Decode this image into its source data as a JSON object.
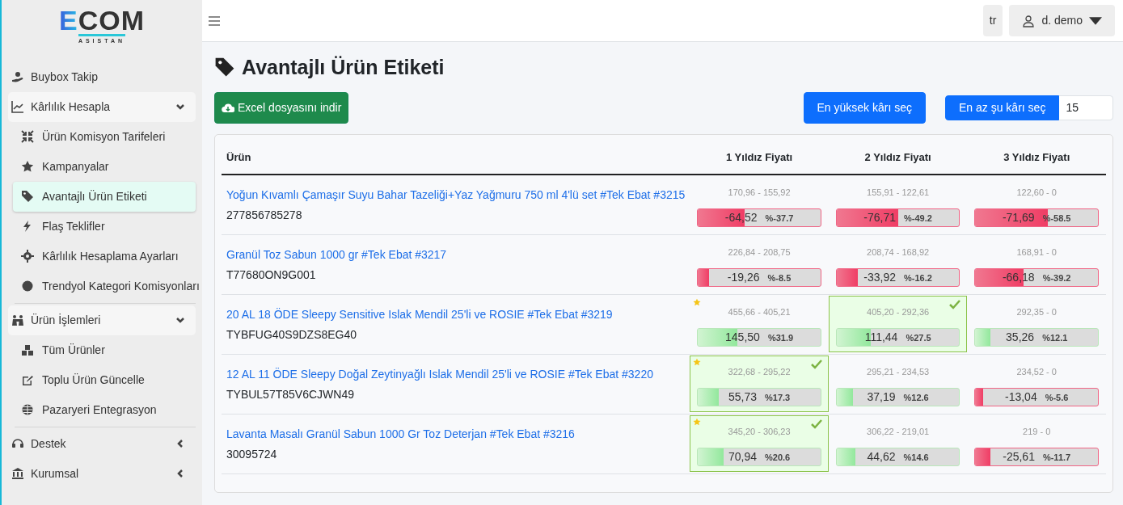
{
  "logo": {
    "text": "ECOM",
    "tagline": "ASISTAN"
  },
  "sidebar": {
    "items": [
      {
        "label": "Buybox Takip"
      },
      {
        "label": "Kârlılık Hesapla",
        "expanded": true,
        "children": [
          {
            "label": "Ürün Komisyon Tarifeleri",
            "selected": false
          },
          {
            "label": "Kampanyalar",
            "selected": false
          },
          {
            "label": "Avantajlı Ürün Etiketi",
            "selected": true
          },
          {
            "label": "Flaş Teklifler",
            "selected": false
          },
          {
            "label": "Kârlılık Hesaplama Ayarları",
            "selected": false
          },
          {
            "label": "Trendyol Kategori Komisyonları",
            "selected": false
          }
        ]
      },
      {
        "label": "Ürün İşlemleri",
        "expanded": true,
        "children": [
          {
            "label": "Tüm Ürünler",
            "selected": false
          },
          {
            "label": "Toplu Ürün Güncelle",
            "selected": false
          },
          {
            "label": "Pazaryeri Entegrasyon",
            "selected": false
          }
        ]
      },
      {
        "label": "Destek",
        "expanded": false
      },
      {
        "label": "Kurumsal",
        "expanded": false
      }
    ]
  },
  "topbar": {
    "language": "tr",
    "user": "d. demo"
  },
  "page": {
    "title": "Avantajlı Ürün Etiketi",
    "download_button": "Excel dosyasını indir",
    "max_button": "En yüksek kârı seç",
    "min_button": "En az şu kârı seç",
    "min_value": "15"
  },
  "table": {
    "columns": [
      "Ürün",
      "1 Yıldız Fiyatı",
      "2 Yıldız Fiyatı",
      "3 Yıldız Fiyatı"
    ],
    "rows": [
      {
        "cells": [
          {
            "name": "Yoğun Kıvamlı Çamaşır Suyu Bahar Tazeliği+Yaz Yağmuru 750 ml 4'lü set #Tek Ebat #3215",
            "code": "277856785278"
          },
          {
            "range": "170,96 - 155,92",
            "value": "-64,52",
            "percent": "%-37.7",
            "kind": "loss",
            "level": 0.38,
            "selected": false,
            "starred": false
          },
          {
            "range": "155,91 - 122,61",
            "value": "-76,71",
            "percent": "%-49.2",
            "kind": "loss",
            "level": 0.5,
            "selected": false,
            "starred": false
          },
          {
            "range": "122,60 - 0",
            "value": "-71,69",
            "percent": "%-58.5",
            "kind": "loss",
            "level": 0.59,
            "selected": false,
            "starred": false
          }
        ]
      },
      {
        "cells": [
          {
            "name": "Granül Toz Sabun 1000 gr #Tek Ebat #3217",
            "code": "T77680ON9G001"
          },
          {
            "range": "226,84 - 208,75",
            "value": "-19,26",
            "percent": "%-8.5",
            "kind": "loss",
            "level": 0.09,
            "selected": false,
            "starred": false
          },
          {
            "range": "208,74 - 168,92",
            "value": "-33,92",
            "percent": "%-16.2",
            "kind": "loss",
            "level": 0.17,
            "selected": false,
            "starred": false
          },
          {
            "range": "168,91 - 0",
            "value": "-66,18",
            "percent": "%-39.2",
            "kind": "loss",
            "level": 0.39,
            "selected": false,
            "starred": false
          }
        ]
      },
      {
        "cells": [
          {
            "name": "20 AL 18 ÖDE Sleepy Sensitive Islak Mendil 25'li ve ROSIE #Tek Ebat #3219",
            "code": "TYBFUG40S9DZS8EG40"
          },
          {
            "range": "455,66 - 405,21",
            "value": "145,50",
            "percent": "%31.9",
            "kind": "gain",
            "level": 0.32,
            "selected": false,
            "starred": true
          },
          {
            "range": "405,20 - 292,36",
            "value": "111,44",
            "percent": "%27.5",
            "kind": "gain",
            "level": 0.28,
            "selected": true,
            "starred": false
          },
          {
            "range": "292,35 - 0",
            "value": "35,26",
            "percent": "%12.1",
            "kind": "gain",
            "level": 0.12,
            "selected": false,
            "starred": false
          }
        ]
      },
      {
        "cells": [
          {
            "name": "12 AL 11 ÖDE Sleepy Doğal Zeytinyağlı Islak Mendil 25'li ve ROSIE #Tek Ebat #3220",
            "code": "TYBUL57T85V6CJWN49"
          },
          {
            "range": "322,68 - 295,22",
            "value": "55,73",
            "percent": "%17.3",
            "kind": "gain",
            "level": 0.17,
            "selected": true,
            "starred": true
          },
          {
            "range": "295,21 - 234,53",
            "value": "37,19",
            "percent": "%12.6",
            "kind": "gain",
            "level": 0.13,
            "selected": false,
            "starred": false
          },
          {
            "range": "234,52 - 0",
            "value": "-13,04",
            "percent": "%-5.6",
            "kind": "loss",
            "level": 0.06,
            "selected": false,
            "starred": false
          }
        ]
      },
      {
        "cells": [
          {
            "name": "Lavanta Masalı Granül Sabun 1000 Gr Toz Deterjan #Tek Ebat #3216",
            "code": "30095724"
          },
          {
            "range": "345,20 - 306,23",
            "value": "70,94",
            "percent": "%20.6",
            "kind": "gain",
            "level": 0.21,
            "selected": true,
            "starred": true
          },
          {
            "range": "306,22 - 219,01",
            "value": "44,62",
            "percent": "%14.6",
            "kind": "gain",
            "level": 0.15,
            "selected": false,
            "starred": false
          },
          {
            "range": "219 - 0",
            "value": "-25,61",
            "percent": "%-11.7",
            "kind": "loss",
            "level": 0.12,
            "selected": false,
            "starred": false
          }
        ]
      }
    ]
  }
}
